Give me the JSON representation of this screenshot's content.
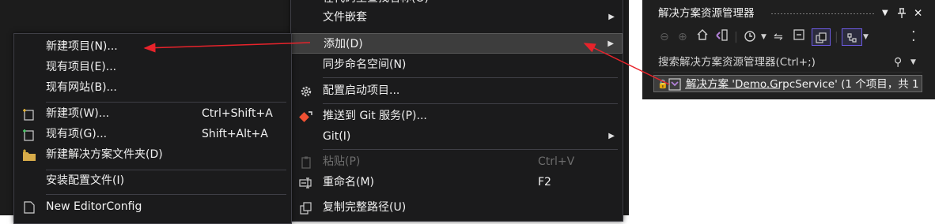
{
  "colors": {
    "accent": "#6e5ce6",
    "arrow": "#e8232b",
    "menu_bg": "#1b1b1c",
    "highlight": "#3d3d3d"
  },
  "top_menu": {
    "items": [
      {
        "label": "在代码里查找名称(O)",
        "arrow": false
      },
      {
        "label": "文件嵌套",
        "arrow": true
      },
      {
        "label": "添加(D)",
        "arrow": true,
        "highlighted": true
      },
      {
        "label": "同步命名空间(N)",
        "arrow": false
      },
      {
        "label": "配置启动项目...",
        "icon": "gear-icon"
      },
      {
        "label": "推送到 Git 服务(P)...",
        "icon": "git-push-icon"
      },
      {
        "label": "Git(I)",
        "arrow": true
      },
      {
        "label": "粘贴(P)",
        "shortcut": "Ctrl+V",
        "disabled": true,
        "icon": "paste-icon"
      },
      {
        "label": "重命名(M)",
        "shortcut": "F2",
        "icon": "rename-icon"
      },
      {
        "label": "复制完整路径(U)",
        "icon": "copy-path-icon"
      }
    ]
  },
  "submenu": {
    "items": [
      {
        "label": "新建项目(N)..."
      },
      {
        "label": "现有项目(E)..."
      },
      {
        "label": "现有网站(B)..."
      },
      {
        "label": "新建项(W)...",
        "shortcut": "Ctrl+Shift+A",
        "icon": "new-item-icon"
      },
      {
        "label": "现有项(G)...",
        "shortcut": "Shift+Alt+A",
        "icon": "existing-item-icon"
      },
      {
        "label": "新建解决方案文件夹(D)",
        "icon": "new-folder-icon"
      },
      {
        "label": "安装配置文件(I)"
      },
      {
        "label": "New EditorConfig",
        "icon": "editorconfig-icon"
      }
    ]
  },
  "solution_explorer": {
    "title": "解决方案资源管理器",
    "search_placeholder": "搜索解决方案资源管理器(Ctrl+;)",
    "solution_row": "解决方案 'Demo.GrpcService' (1 个项目，共 1"
  }
}
